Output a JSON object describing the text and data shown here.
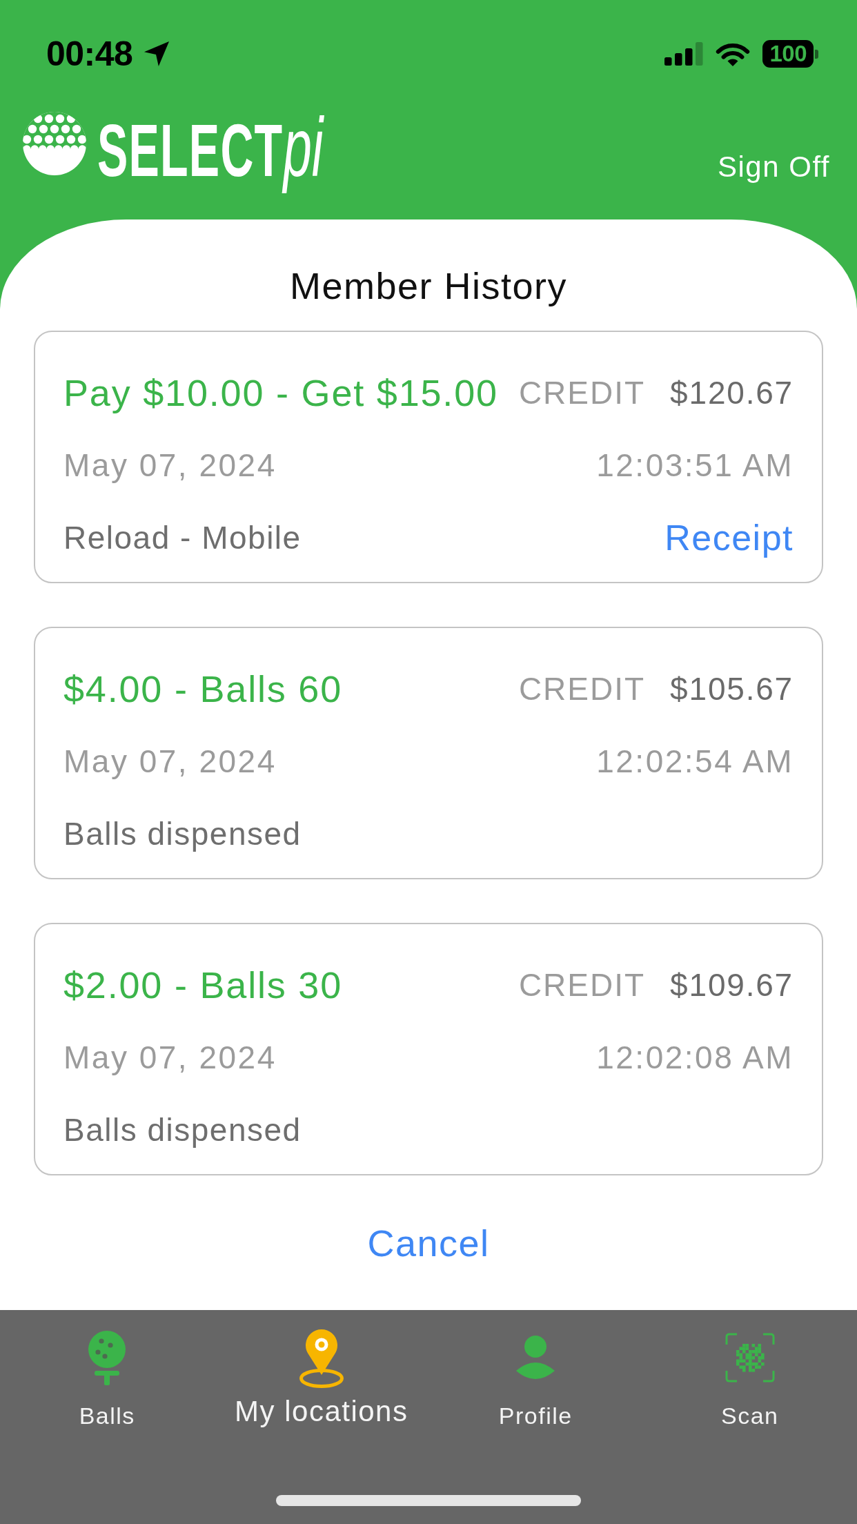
{
  "status_bar": {
    "time": "00:48",
    "battery": "100"
  },
  "header": {
    "logo": {
      "name": "SELECT",
      "suffix": "pi"
    },
    "sign_off": "Sign Off"
  },
  "screen_title": "Member History",
  "transactions": [
    {
      "title": "Pay $10.00 - Get $15.00",
      "type": "CREDIT",
      "balance": "$120.67",
      "date": "May 07, 2024",
      "time": "12:03:51 AM",
      "description": "Reload - Mobile",
      "action": "Receipt"
    },
    {
      "title": "$4.00 - Balls 60",
      "type": "CREDIT",
      "balance": "$105.67",
      "date": "May 07, 2024",
      "time": "12:02:54 AM",
      "description": "Balls dispensed"
    },
    {
      "title": "$2.00 - Balls 30",
      "type": "CREDIT",
      "balance": "$109.67",
      "date": "May 07, 2024",
      "time": "12:02:08 AM",
      "description": "Balls dispensed"
    }
  ],
  "cancel": "Cancel",
  "tabs": [
    {
      "label": "Balls",
      "selected": false
    },
    {
      "label": "My locations",
      "selected": true
    },
    {
      "label": "Profile",
      "selected": false
    },
    {
      "label": "Scan",
      "selected": false
    }
  ]
}
